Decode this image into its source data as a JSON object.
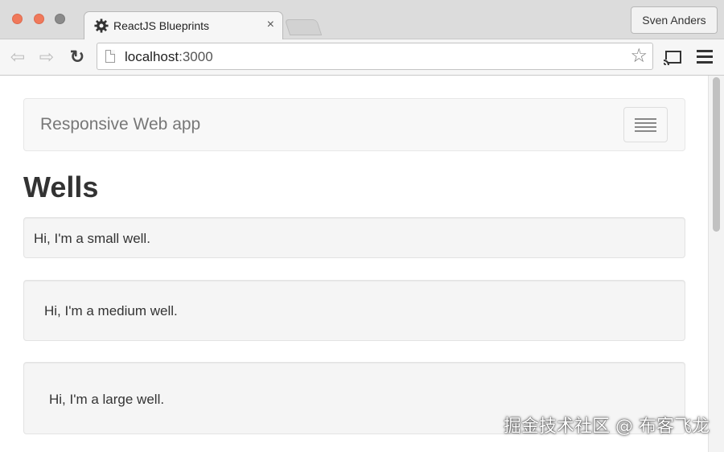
{
  "browser": {
    "tab": {
      "title": "ReactJS Blueprints",
      "close_label": "×"
    },
    "profile_name": "Sven Anders",
    "address": {
      "host": "localhost",
      "port": ":3000"
    },
    "icons": {
      "back": "back-arrow-icon",
      "forward": "forward-arrow-icon",
      "reload": "reload-icon",
      "star": "bookmark-star-icon",
      "cast": "cast-icon",
      "menu": "hamburger-menu-icon",
      "tab_favicon": "gear-icon"
    }
  },
  "page": {
    "navbar": {
      "brand": "Responsive Web app"
    },
    "heading": "Wells",
    "wells": {
      "small": "Hi, I'm a small well.",
      "medium": "Hi, I'm a medium well.",
      "large": "Hi, I'm a large well."
    }
  },
  "watermark": "掘金技术社区 @ 布客飞龙",
  "colors": {
    "traffic_close": "#f0795b",
    "traffic_minimize": "#f0795b",
    "navbar_bg": "#f8f8f8",
    "well_bg": "#f5f5f5",
    "heading_text": "#333333"
  }
}
